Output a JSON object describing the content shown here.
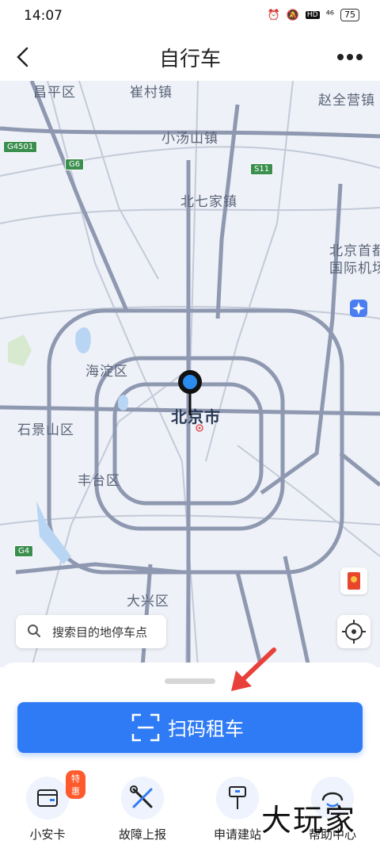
{
  "status_bar": {
    "time": "14:07",
    "network": "⁴⁶",
    "battery": "75"
  },
  "header": {
    "title": "自行车"
  },
  "map": {
    "labels": {
      "changping": "昌平区",
      "cuicun": "崔村镇",
      "zhaoquanying": "赵全营镇",
      "xiaotangshan": "小汤山镇",
      "beiqijia": "北七家镇",
      "airport_l1": "北京首都",
      "airport_l2": "国际机场",
      "haidian": "海淀区",
      "beijing": "北京市",
      "shijingshan": "石景山区",
      "fengtai": "丰台区",
      "daxing": "大兴区"
    },
    "shields": {
      "g4501": "G4501",
      "g6": "G6",
      "s11": "S11",
      "g4": "G4"
    }
  },
  "search": {
    "placeholder": "搜索目的地停车点"
  },
  "primary_action": {
    "label": "扫码租车"
  },
  "quick_actions": [
    {
      "label": "小安卡",
      "badge": "特惠"
    },
    {
      "label": "故障上报"
    },
    {
      "label": "申请建站"
    },
    {
      "label": "帮助中心"
    }
  ],
  "watermark": "大玩家"
}
